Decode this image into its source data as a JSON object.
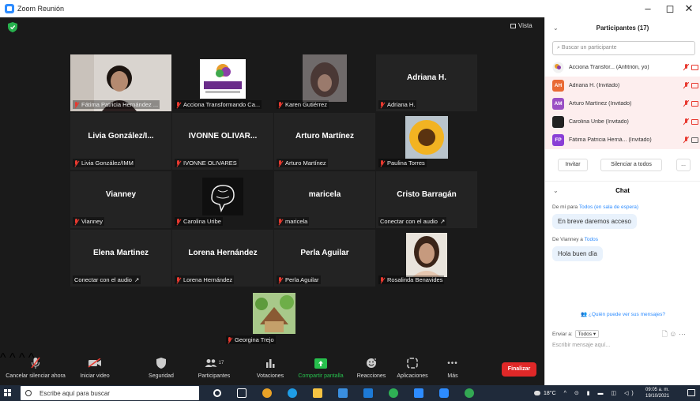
{
  "window": {
    "title": "Zoom Reunión",
    "minimize": "–",
    "maximize": "◻",
    "close": "✕"
  },
  "view_button": "Vista",
  "tiles": [
    {
      "name": "",
      "label": "Fátima Patricia Hernández ...",
      "type": "photo-woman",
      "muted": true,
      "active": false
    },
    {
      "name": "",
      "label": "Acciona Transformando Ca...",
      "type": "logo",
      "muted": true,
      "active": true
    },
    {
      "name": "",
      "label": "Karen Gutiérrez",
      "type": "photo-dark",
      "muted": true,
      "active": false
    },
    {
      "name": "Adriana H.",
      "label": "Adriana H.",
      "type": "name",
      "muted": true,
      "active": false
    },
    {
      "name": "Livia González/I...",
      "label": "Livia González/IMM",
      "type": "name",
      "muted": true,
      "active": false
    },
    {
      "name": "IVONNE OLIVAR...",
      "label": "IVONNE OLIVARES",
      "type": "name",
      "muted": true,
      "active": false
    },
    {
      "name": "Arturo Martínez",
      "label": "Arturo Martínez",
      "type": "name",
      "muted": true,
      "active": false
    },
    {
      "name": "",
      "label": "Paulina Torres",
      "type": "photo-sunflower",
      "muted": true,
      "active": false
    },
    {
      "name": "Vianney",
      "label": "Vianney",
      "type": "name",
      "muted": true,
      "active": false
    },
    {
      "name": "",
      "label": "Carolina Uribe",
      "type": "photo-brain",
      "muted": true,
      "active": false
    },
    {
      "name": "maricela",
      "label": "maricela",
      "type": "name",
      "muted": true,
      "active": false
    },
    {
      "name": "Cristo Barragán",
      "label": "Conectar con el audio",
      "type": "name",
      "muted": false,
      "active": false
    },
    {
      "name": "Elena Martinez",
      "label": "Conectar con el audio",
      "type": "name",
      "muted": false,
      "active": false
    },
    {
      "name": "Lorena Hernández",
      "label": "Lorena Hernández",
      "type": "name",
      "muted": true,
      "active": false
    },
    {
      "name": "Perla Aguilar",
      "label": "Perla Aguilar",
      "type": "name",
      "muted": true,
      "active": false
    },
    {
      "name": "",
      "label": "Rosalinda Benavides",
      "type": "photo-woman2",
      "muted": true,
      "active": false
    },
    {
      "name": "",
      "label": "Georgina Trejo",
      "type": "photo-house",
      "muted": true,
      "active": false
    }
  ],
  "toolbar": {
    "mute": "Cancelar silenciar ahora",
    "video": "Iniciar video",
    "security": "Seguridad",
    "participants": "Participantes",
    "participants_count": "17",
    "polls": "Votaciones",
    "share": "Compartir pantalla",
    "reactions": "Reacciones",
    "apps": "Aplicaciones",
    "more": "Más",
    "end": "Finalizar"
  },
  "panel": {
    "participants_title": "Participantes (17)",
    "search_placeholder": "Buscar un participante",
    "participants": [
      {
        "initials": "",
        "name": "Acciona Transfor... (Anfitrión, yo)",
        "color": "#f4f4f4"
      },
      {
        "initials": "AH",
        "name": "Adriana H. (Invitado)",
        "color": "#e96a35"
      },
      {
        "initials": "AM",
        "name": "Arturo Martínez (Invitado)",
        "color": "#9a4fc4"
      },
      {
        "initials": "",
        "name": "Carolina Uribe (Invitado)",
        "color": "#222222"
      },
      {
        "initials": "FP",
        "name": "Fátima Patricia Hernà... (Invitado)",
        "color": "#8a3fd6"
      }
    ],
    "invite": "Invitar",
    "mute_all": "Silenciar a todos",
    "more": "...",
    "chat_title": "Chat",
    "messages": [
      {
        "from": "De mí para",
        "to": "Todos (en sala de espera)",
        "text": "En breve daremos acceso"
      },
      {
        "from": "De Vianney a",
        "to": "Todos",
        "text": "Hola buen día"
      }
    ],
    "who_can_see": "¿Quién puede ver sus mensajes?",
    "send_to_label": "Enviar a:",
    "send_to_value": "Todos",
    "input_placeholder": "Escribir mensaje aquí..."
  },
  "taskbar": {
    "search_placeholder": "Escribe aquí para buscar",
    "temperature": "18°C",
    "time": "09:05 a. m.",
    "date": "19/10/2021"
  }
}
